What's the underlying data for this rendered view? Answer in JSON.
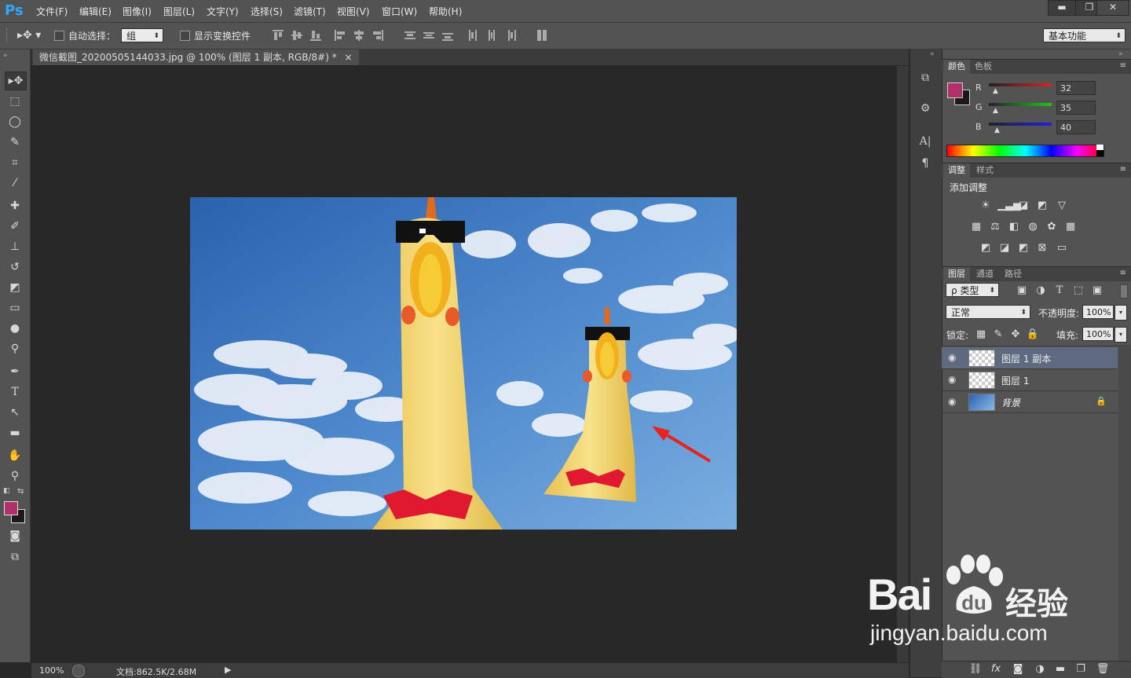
{
  "app": {
    "logo": "Ps"
  },
  "menu": [
    "文件(F)",
    "编辑(E)",
    "图像(I)",
    "图层(L)",
    "文字(Y)",
    "选择(S)",
    "滤镜(T)",
    "视图(V)",
    "窗口(W)",
    "帮助(H)"
  ],
  "window_controls": {
    "minimize": "▬",
    "restore": "❐",
    "close": "✕"
  },
  "options": {
    "auto_select_label": "自动选择：",
    "auto_select_value": "组",
    "show_transform_label": "显示变换控件",
    "workspace_value": "基本功能"
  },
  "document_tab": {
    "title": "微信截图_20200505144033.jpg @ 100% (图层 1 副本, RGB/8#) *",
    "close": "×"
  },
  "status": {
    "zoom": "100%",
    "doc_info": "文档:862.5K/2.68M"
  },
  "color_panel": {
    "tabs": [
      "颜色",
      "色板"
    ],
    "channels": [
      {
        "label": "R",
        "value": "32",
        "color": "#e0201f"
      },
      {
        "label": "G",
        "value": "35",
        "color": "#1ec41e"
      },
      {
        "label": "B",
        "value": "40",
        "color": "#2020e0"
      }
    ],
    "foreground": "#b0306a",
    "background": "#1a1a1a"
  },
  "adjust_panel": {
    "tabs": [
      "调整",
      "样式"
    ],
    "title": "添加调整"
  },
  "layers_panel": {
    "tabs": [
      "图层",
      "通道",
      "路径"
    ],
    "filter_label": "ρ 类型",
    "blend_mode": "正常",
    "opacity_label": "不透明度:",
    "opacity_value": "100%",
    "lock_label": "锁定:",
    "fill_label": "填充:",
    "fill_value": "100%",
    "layers": [
      {
        "name": "图层 1 副本",
        "selected": true
      },
      {
        "name": "图层 1",
        "selected": false
      },
      {
        "name": "背景",
        "selected": false,
        "locked": true
      }
    ]
  },
  "watermark": {
    "brand": "Bai",
    "brand_cn": "经验",
    "url": "jingyan.baidu.com"
  }
}
